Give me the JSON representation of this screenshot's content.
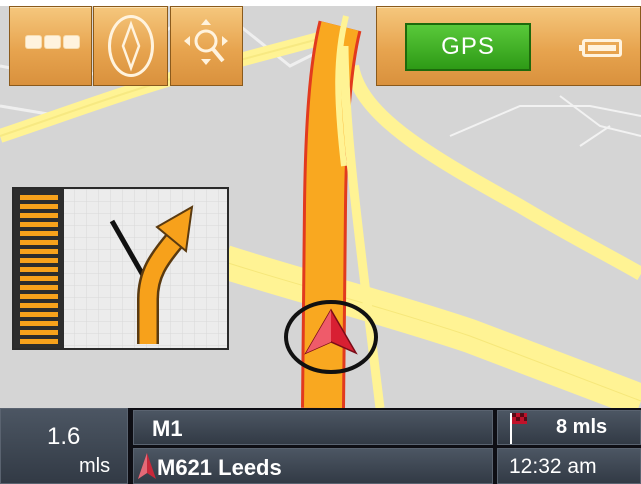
{
  "toolbar": {
    "menu_button": "menu",
    "compass_button": "compass",
    "zoom_button": "zoom",
    "gps_label": "GPS",
    "battery": "battery"
  },
  "map": {
    "road_colors": {
      "highlighted": "#f7a11b",
      "road": "#fff48a",
      "background": "#d6d6d6"
    }
  },
  "turn_instruction": {
    "icon": "bear-right-arrow-icon",
    "lane_indicator": "lane-stripes"
  },
  "bottom_bar": {
    "distance_to_turn": "1.6",
    "distance_unit": "mls",
    "current_road": "M1",
    "next_road": "M621 Leeds",
    "remaining_distance": "8 mls",
    "eta": "12:32 am"
  }
}
